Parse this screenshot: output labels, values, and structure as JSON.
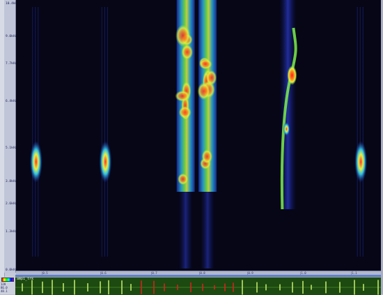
{
  "app": {
    "file_name": "amp1_trk",
    "info_lines": [
      "128",
      "86.0",
      "48.1"
    ]
  },
  "frequency_axis": {
    "labels": [
      "10.4kHz",
      "9.0kHz",
      "7.7kHz",
      "6.4kHz",
      "5.1kHz",
      "3.8kHz",
      "2.6kHz",
      "1.3kHz",
      "0.0kHz"
    ]
  },
  "time_ruler": {
    "ticks": [
      "|0.5",
      "|0.6",
      "|0.7",
      "|0.8",
      "|0.9",
      "|1.0",
      "|1.1"
    ]
  },
  "colors": {
    "spectrogram_bg": "#060616",
    "waveform_bg": "#1d4a10",
    "waveform_normal": "#c8f070",
    "waveform_selected": "#e02020",
    "ruler_bg": "#b2b8cc"
  },
  "spectrogram_bands": [
    {
      "kind": "call",
      "center": 0.055,
      "intensity": "medium"
    },
    {
      "kind": "call",
      "center": 0.245,
      "intensity": "medium"
    },
    {
      "kind": "burst",
      "center": 0.465,
      "intensity": "high"
    },
    {
      "kind": "burst",
      "center": 0.525,
      "intensity": "high"
    },
    {
      "kind": "sweep",
      "center": 0.745,
      "intensity": "high"
    },
    {
      "kind": "call",
      "center": 0.945,
      "intensity": "medium"
    }
  ]
}
